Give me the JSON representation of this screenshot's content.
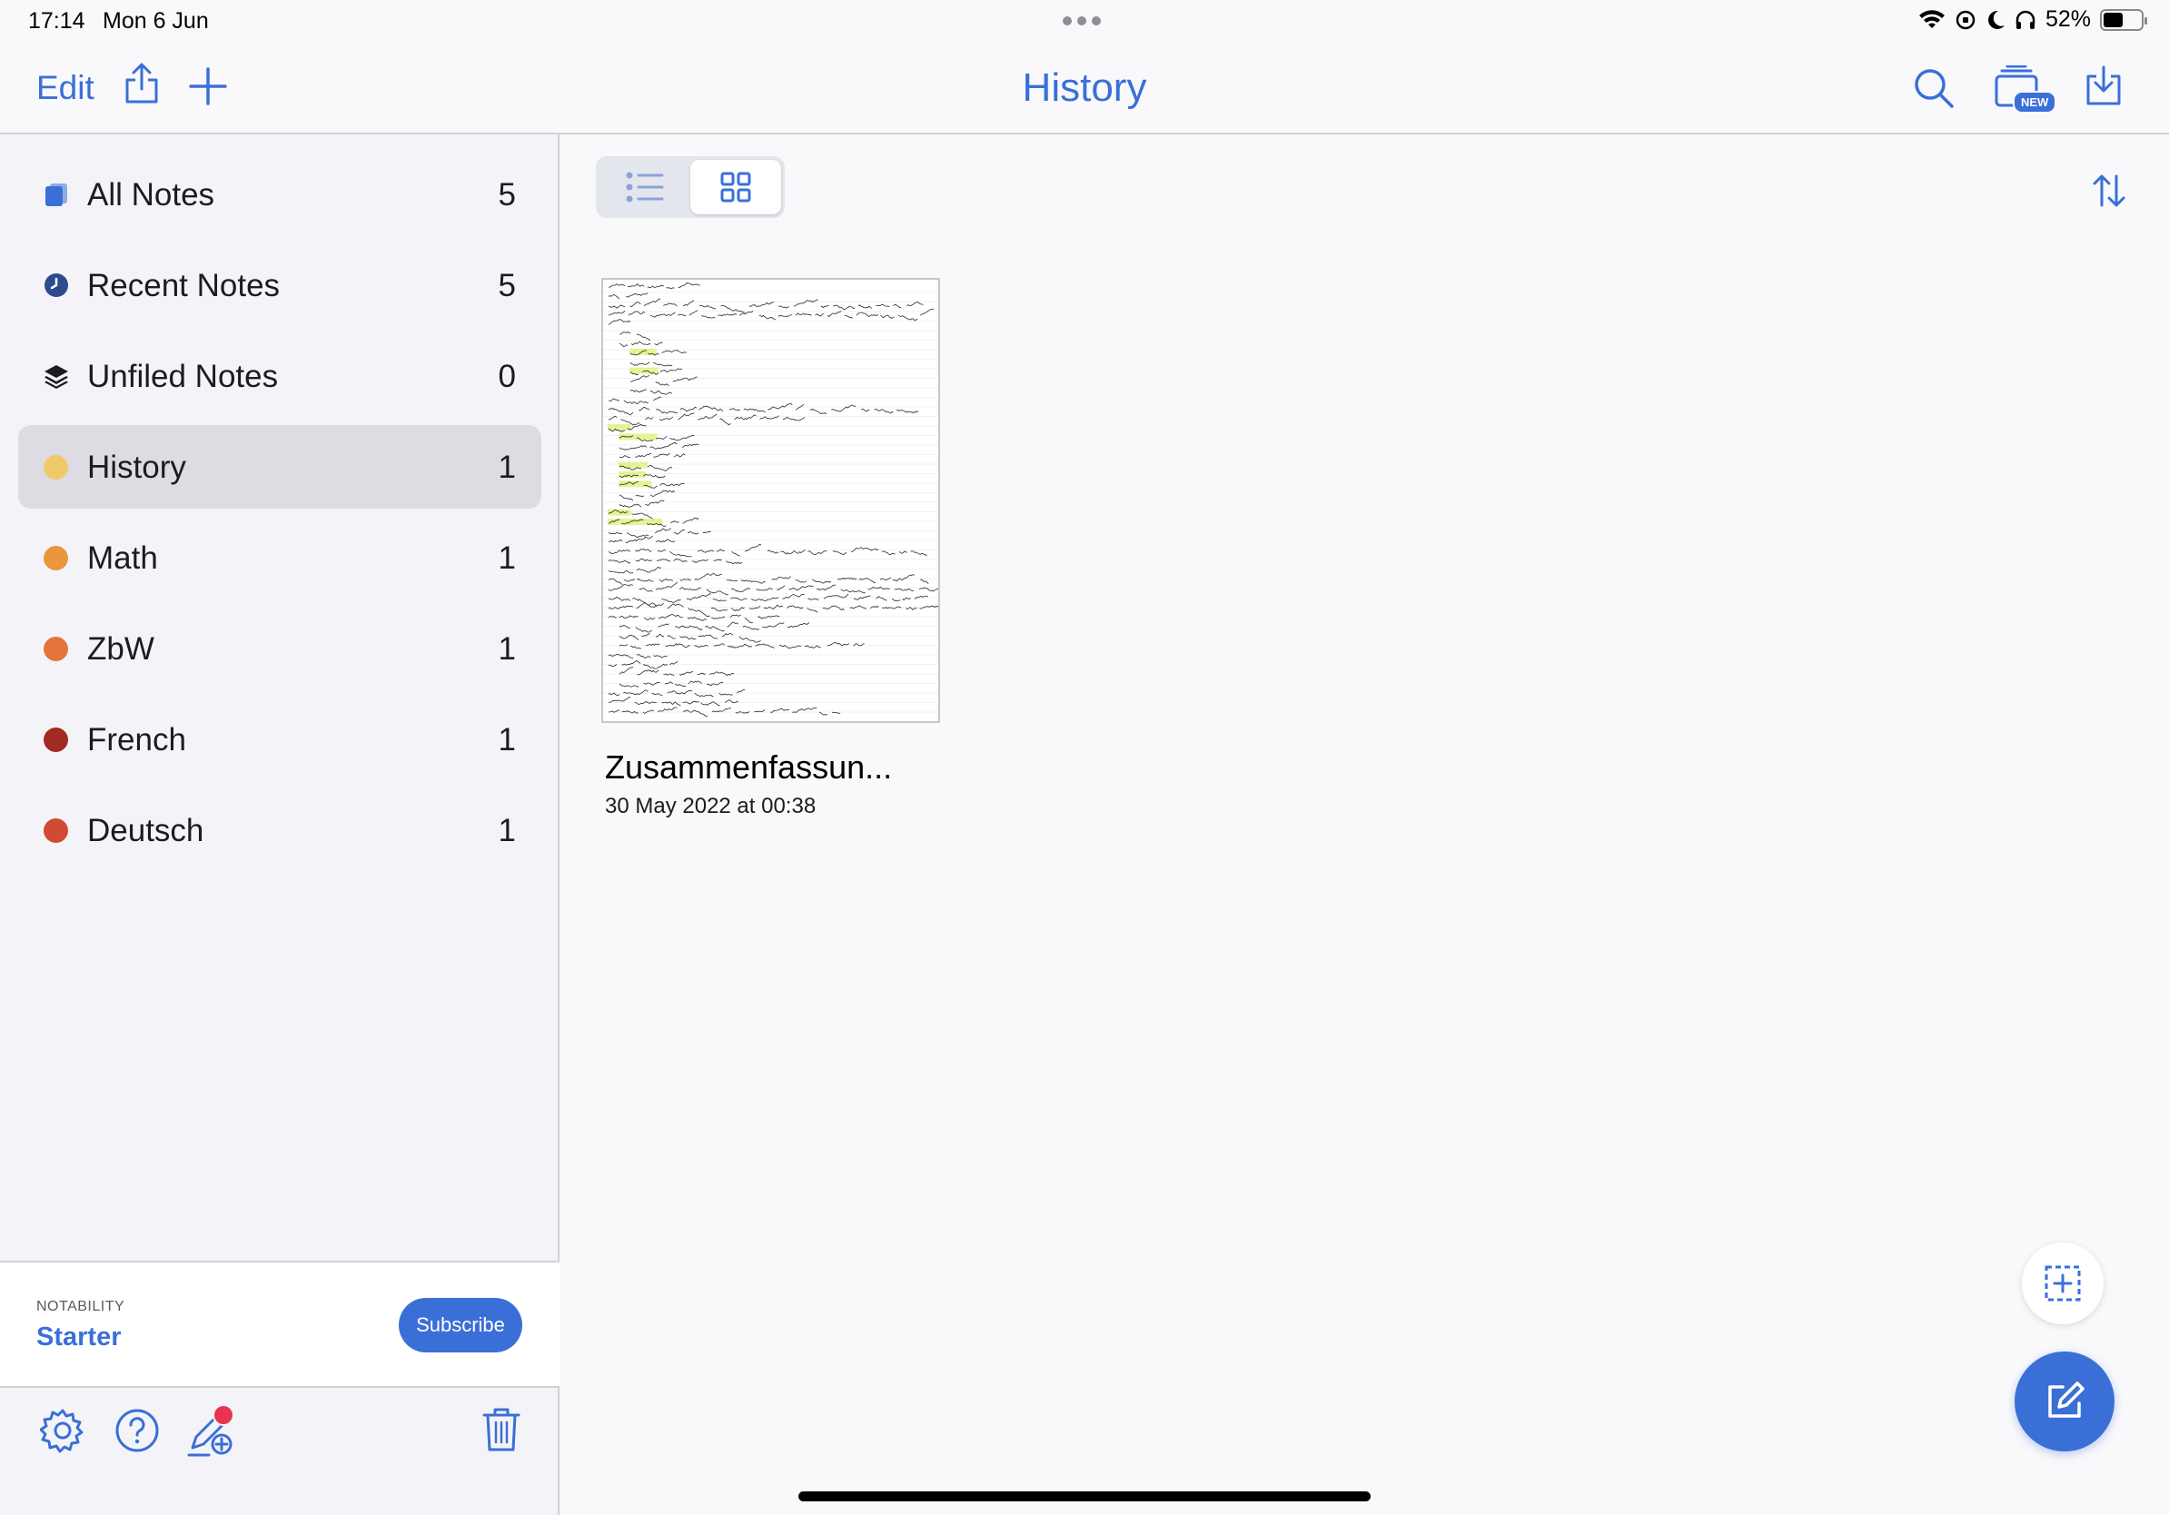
{
  "status_bar": {
    "time": "17:14",
    "date": "Mon 6 Jun",
    "battery": "52%",
    "battery_level": 0.52
  },
  "nav": {
    "edit_label": "Edit",
    "title": "History",
    "new_badge": "NEW",
    "accent": "#3a6fd8"
  },
  "sidebar": {
    "items": [
      {
        "label": "All Notes",
        "count": "5",
        "icon": "all-notes-icon"
      },
      {
        "label": "Recent Notes",
        "count": "5",
        "icon": "clock-icon"
      },
      {
        "label": "Unfiled Notes",
        "count": "0",
        "icon": "stack-icon"
      },
      {
        "label": "History",
        "count": "1",
        "color": "#f0c96a",
        "active": true
      },
      {
        "label": "Math",
        "count": "1",
        "color": "#e8973c"
      },
      {
        "label": "ZbW",
        "count": "1",
        "color": "#e5743a"
      },
      {
        "label": "French",
        "count": "1",
        "color": "#a12a22"
      },
      {
        "label": "Deutsch",
        "count": "1",
        "color": "#d14a32"
      }
    ],
    "plan": {
      "brand": "NOTABILITY",
      "name": "Starter",
      "subscribe_label": "Subscribe"
    }
  },
  "main": {
    "view_mode": "grid",
    "notes": [
      {
        "title": "Zusammenfassun...",
        "date": "30 May 2022 at 00:38"
      }
    ]
  }
}
